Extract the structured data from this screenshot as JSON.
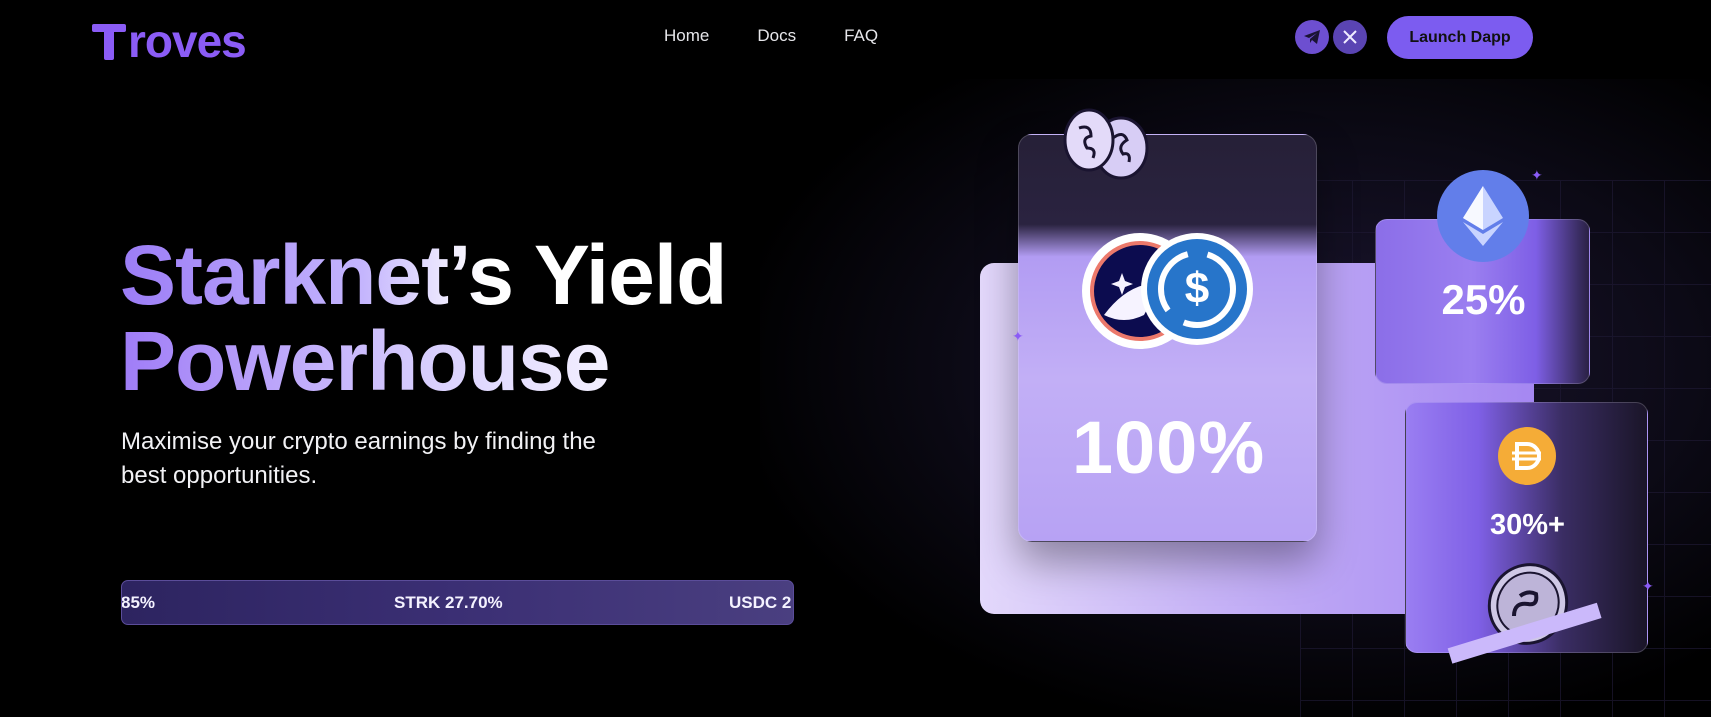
{
  "header": {
    "logo_text": "Troves",
    "nav": [
      {
        "label": "Home"
      },
      {
        "label": "Docs"
      },
      {
        "label": "FAQ"
      }
    ],
    "social": [
      {
        "icon": "telegram-icon"
      },
      {
        "icon": "x-icon"
      }
    ],
    "launch_label": "Launch Dapp"
  },
  "hero": {
    "title_line1": "Starknet’s Yield",
    "title_line2": "Powerhouse",
    "subtitle": "Maximise your crypto earnings by finding the best opportunities.",
    "ticker": [
      {
        "text": "85%"
      },
      {
        "text": "STRK 27.70%"
      },
      {
        "text": "USDC 2"
      }
    ]
  },
  "visual": {
    "main_card_pct": "100%",
    "eth_card_pct": "25%",
    "dai_card_pct": "30%+"
  },
  "colors": {
    "accent": "#8b5cf6",
    "button": "#7c5cf0",
    "eth": "#627eea",
    "usdc": "#2775ca",
    "dai": "#f5ac37"
  }
}
